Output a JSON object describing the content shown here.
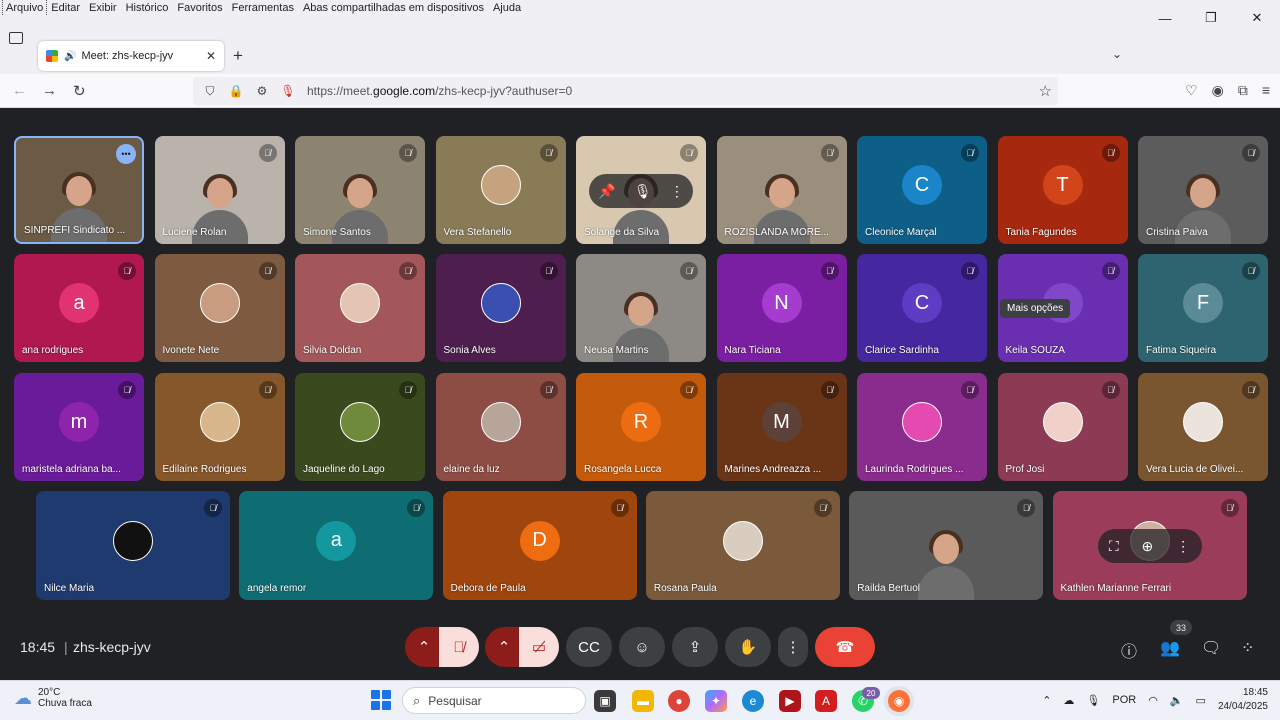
{
  "menu": [
    "Arquivo",
    "Editar",
    "Exibir",
    "Histórico",
    "Favoritos",
    "Ferramentas",
    "Abas compartilhadas em dispositivos",
    "Ajuda"
  ],
  "tab": {
    "title": "Meet: zhs-kecp-jyv",
    "close": "✕"
  },
  "url": {
    "prefix": "https://meet.",
    "domain": "google.com",
    "suffix": "/zhs-kecp-jyv?authuser=0"
  },
  "participants": [
    {
      "name": "SINPREFI Sindicato ...",
      "type": "video",
      "bg": "#6b5a44",
      "speaking": true
    },
    {
      "name": "Luciene Rolan",
      "type": "video",
      "bg": "#b9b3ab"
    },
    {
      "name": "Simone Santos",
      "type": "video",
      "bg": "#8c8470"
    },
    {
      "name": "Vera Stefanello",
      "type": "photo",
      "bg": "#8a7b57",
      "ph": "#c7a27f"
    },
    {
      "name": "Solange da Silva",
      "type": "video",
      "bg": "#d8c8b0"
    },
    {
      "name": "ROZISLANDA MORE...",
      "type": "video",
      "bg": "#9a8e7d"
    },
    {
      "name": "Cleonice Marçal",
      "type": "letter",
      "letter": "C",
      "bg": "#0e5f88",
      "av": "#1a86c9"
    },
    {
      "name": "Tania Fagundes",
      "type": "letter",
      "letter": "T",
      "bg": "#a6280f",
      "av": "#d2451a"
    },
    {
      "name": "Cristina Paiva",
      "type": "video",
      "bg": "#5c5c5c"
    },
    {
      "name": "ana rodrigues",
      "type": "letter",
      "letter": "a",
      "bg": "#b0184f",
      "av": "#e0336f"
    },
    {
      "name": "Ivonete Nete",
      "type": "photo",
      "bg": "#7d5a40",
      "ph": "#c89c7e"
    },
    {
      "name": "Silvia Doldan",
      "type": "photo",
      "bg": "#a4575b",
      "ph": "#e4c4b3"
    },
    {
      "name": "Sonia Alves",
      "type": "photo",
      "bg": "#4e1f4e",
      "ph": "#3a4fb0"
    },
    {
      "name": "Neusa Martins",
      "type": "video",
      "bg": "#8d8a86"
    },
    {
      "name": "Nara Ticiana",
      "type": "letter",
      "letter": "N",
      "bg": "#7b1fa2",
      "av": "#a63bd0"
    },
    {
      "name": "Clarice Sardinha",
      "type": "letter",
      "letter": "C",
      "bg": "#4527a0",
      "av": "#5e3cc4"
    },
    {
      "name": "Keila SOUZA",
      "type": "letter",
      "letter": "",
      "bg": "#6a2fb0",
      "av": "#8048c9"
    },
    {
      "name": "Fatima Siqueira",
      "type": "letter",
      "letter": "F",
      "bg": "#2d6470",
      "av": "#5b8b96"
    },
    {
      "name": "maristela adriana ba...",
      "type": "letter",
      "letter": "m",
      "bg": "#6a1b9a",
      "av": "#8e24aa"
    },
    {
      "name": "Edilaine Rodrigues",
      "type": "photo",
      "bg": "#86572a",
      "ph": "#d6b68a"
    },
    {
      "name": "Jaqueline do Lago",
      "type": "photo",
      "bg": "#3b4a1e",
      "ph": "#6f8a3a"
    },
    {
      "name": "elaine da luz",
      "type": "photo",
      "bg": "#8e4d44",
      "ph": "#b8a59a"
    },
    {
      "name": "Rosangela Lucca",
      "type": "letter",
      "letter": "R",
      "bg": "#c35a0c",
      "av": "#ee6c11"
    },
    {
      "name": "Marines Andreazza ...",
      "type": "letter",
      "letter": "M",
      "bg": "#6a3416",
      "av": "#5d4037"
    },
    {
      "name": "Laurinda Rodrigues ...",
      "type": "photo",
      "bg": "#8a2b8e",
      "ph": "#e44ab0"
    },
    {
      "name": "Prof Josi",
      "type": "photo",
      "bg": "#8d3a55",
      "ph": "#f0d0c8"
    },
    {
      "name": "Vera Lucia de Olivei...",
      "type": "photo",
      "bg": "#7a5630",
      "ph": "#ece4dc"
    },
    {
      "name": "Nilce Maria",
      "type": "photo",
      "bg": "#1f3a6e",
      "ph": "#111"
    },
    {
      "name": "angela remor",
      "type": "letter",
      "letter": "a",
      "bg": "#0e6d73",
      "av": "#1498a0"
    },
    {
      "name": "Debora de Paula",
      "type": "letter",
      "letter": "D",
      "bg": "#a0450d",
      "av": "#ef6c10"
    },
    {
      "name": "Rosana Paula",
      "type": "photo",
      "bg": "#7b5a3b",
      "ph": "#d9cdbf"
    },
    {
      "name": "Railda Bertuol",
      "type": "video",
      "bg": "#5a5a5a"
    },
    {
      "name": "Kathlen Marianne Ferrari",
      "type": "photo",
      "bg": "#9b3d5a",
      "ph": "#d0b0a0"
    }
  ],
  "tooltip": "Mais opções",
  "meeting": {
    "time": "18:45",
    "separator": "|",
    "code": "zhs-kecp-jyv",
    "participant_count": "33"
  },
  "taskbar": {
    "temp": "20°C",
    "weather": "Chuva fraca",
    "search_placeholder": "Pesquisar",
    "whatsapp_badge": "20",
    "lang": "POR",
    "time": "18:45",
    "date": "24/04/2025"
  }
}
